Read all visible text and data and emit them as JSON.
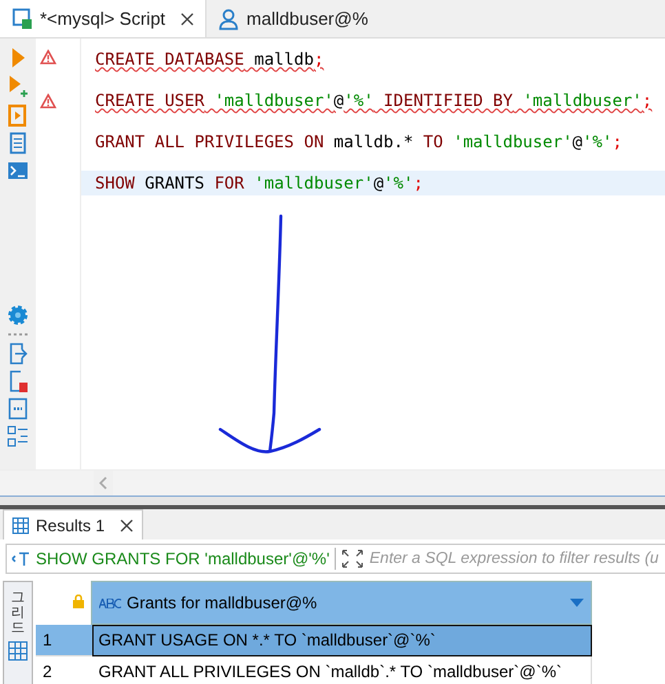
{
  "editor_tabs": [
    {
      "label": "*<mysql> Script",
      "kind": "script",
      "selected": true,
      "closable": true
    },
    {
      "label": "malldbuser@%",
      "kind": "user",
      "selected": false,
      "closable": false
    }
  ],
  "code_lines": [
    {
      "error": true,
      "current": false,
      "tokens": [
        {
          "kind": "keyword",
          "text": "CREATE DATABASE"
        },
        {
          "kind": "plain",
          "text": " malldb"
        },
        {
          "kind": "punct",
          "text": ";"
        }
      ]
    },
    {
      "error": true,
      "current": false,
      "tokens": [
        {
          "kind": "keyword",
          "text": "CREATE USER"
        },
        {
          "kind": "string",
          "text": " 'malldbuser'"
        },
        {
          "kind": "plain",
          "text": "@"
        },
        {
          "kind": "string",
          "text": "'%'"
        },
        {
          "kind": "keyword",
          "text": " IDENTIFIED BY"
        },
        {
          "kind": "string",
          "text": " 'malldbuser'"
        },
        {
          "kind": "punct",
          "text": ";"
        }
      ]
    },
    {
      "error": false,
      "current": false,
      "tokens": [
        {
          "kind": "keyword",
          "text": "GRANT ALL PRIVILEGES ON"
        },
        {
          "kind": "plain",
          "text": " malldb.* "
        },
        {
          "kind": "keyword",
          "text": "TO"
        },
        {
          "kind": "string",
          "text": " 'malldbuser'"
        },
        {
          "kind": "plain",
          "text": "@"
        },
        {
          "kind": "string",
          "text": "'%'"
        },
        {
          "kind": "punct",
          "text": ";"
        }
      ]
    },
    {
      "error": false,
      "current": true,
      "tokens": [
        {
          "kind": "keyword",
          "text": "SHOW"
        },
        {
          "kind": "plain",
          "text": " GRANTS "
        },
        {
          "kind": "keyword",
          "text": "FOR"
        },
        {
          "kind": "string",
          "text": " 'malldbuser'"
        },
        {
          "kind": "plain",
          "text": "@"
        },
        {
          "kind": "string",
          "text": "'%'"
        },
        {
          "kind": "punct",
          "text": ";"
        }
      ]
    }
  ],
  "results_tab": {
    "label": "Results 1",
    "selected": true
  },
  "filter_bar": {
    "query": "SHOW GRANTS FOR 'malldbuser'@'%'",
    "placeholder": "Enter a SQL expression to filter results (u"
  },
  "side_label": "그리드",
  "grid": {
    "column": "Grants for malldbuser@%",
    "rows": [
      {
        "number": "1",
        "value": "GRANT USAGE ON *.* TO `malldbuser`@`%`",
        "selected": true
      },
      {
        "number": "2",
        "value": "GRANT ALL PRIVILEGES ON `malldb`.* TO `malldbuser`@`%`",
        "selected": false
      }
    ]
  }
}
